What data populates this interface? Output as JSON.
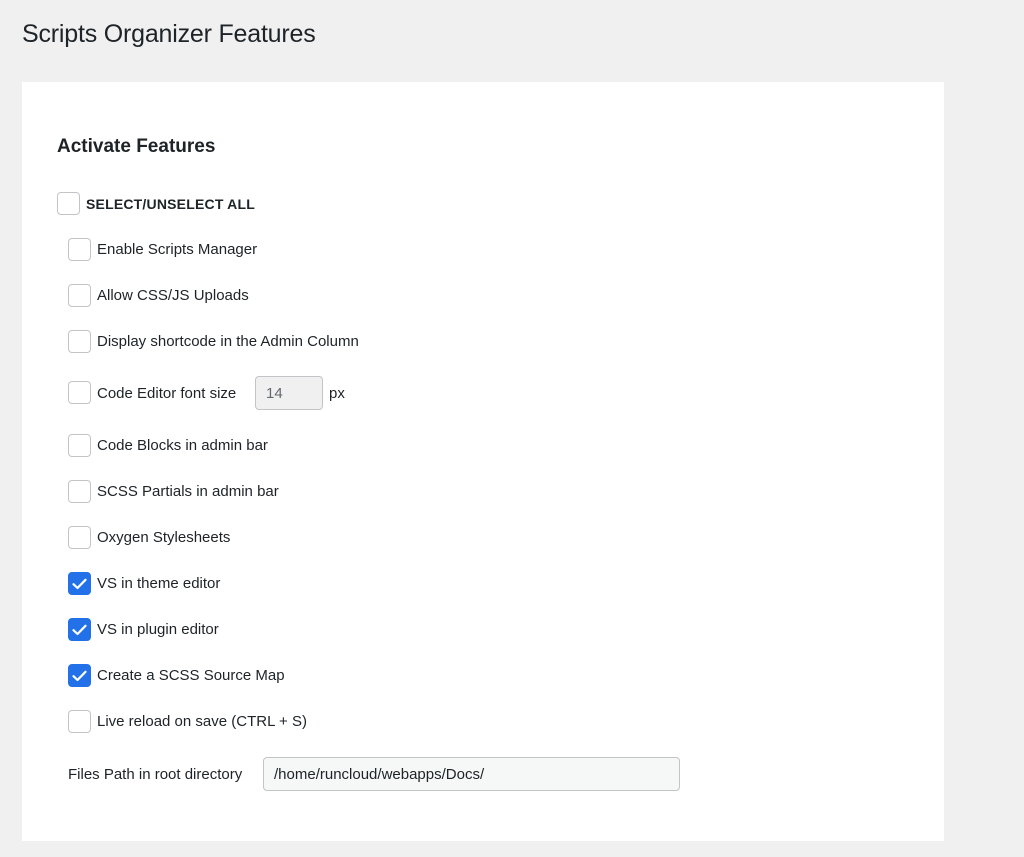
{
  "page": {
    "title": "Scripts Organizer Features"
  },
  "section": {
    "title": "Activate Features"
  },
  "select_all": {
    "label": "SELECT/UNSELECT ALL",
    "checked": false
  },
  "features": [
    {
      "label": "Enable Scripts Manager",
      "checked": false
    },
    {
      "label": "Allow CSS/JS Uploads",
      "checked": false
    },
    {
      "label": "Display shortcode in the Admin Column",
      "checked": false
    },
    {
      "label": "Code Editor font size",
      "checked": false
    },
    {
      "label": "Code Blocks in admin bar",
      "checked": false
    },
    {
      "label": "SCSS Partials in admin bar",
      "checked": false
    },
    {
      "label": "Oxygen Stylesheets",
      "checked": false
    },
    {
      "label": "VS in theme editor",
      "checked": true
    },
    {
      "label": "VS in plugin editor",
      "checked": true
    },
    {
      "label": "Create a SCSS Source Map",
      "checked": true
    },
    {
      "label": "Live reload on save (CTRL + S)",
      "checked": false
    }
  ],
  "font_size": {
    "value": "14",
    "unit": "px"
  },
  "files_path": {
    "label": "Files Path in root directory",
    "value": "/home/runcloud/webapps/Docs/"
  },
  "colors": {
    "checkbox_checked": "#2271e8",
    "background": "#f0f0f1",
    "card": "#ffffff"
  }
}
